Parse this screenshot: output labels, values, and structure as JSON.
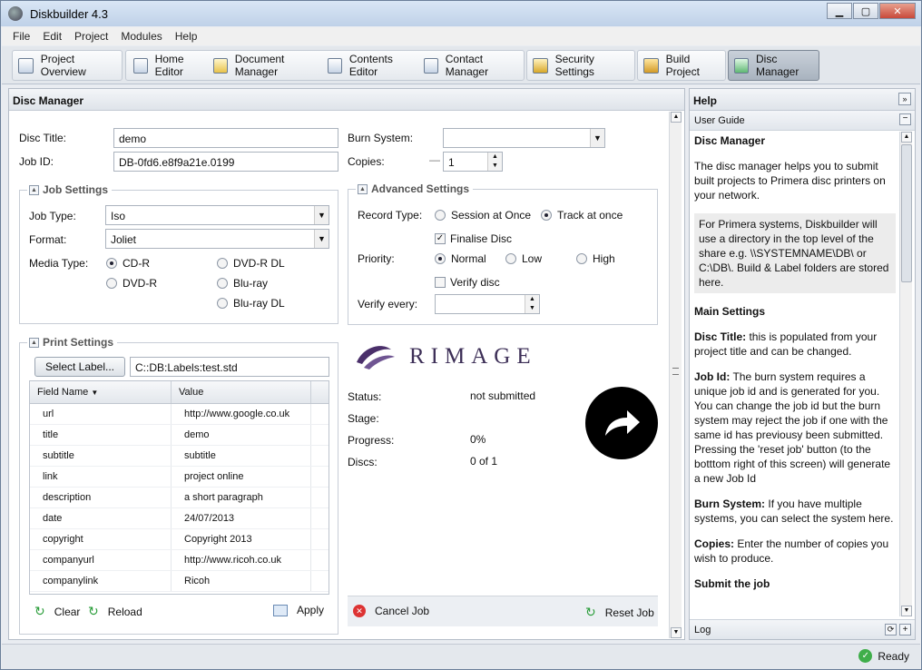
{
  "window": {
    "title": "Diskbuilder 4.3"
  },
  "menu": [
    "File",
    "Edit",
    "Project",
    "Modules",
    "Help"
  ],
  "toolbar": [
    "Project Overview",
    "Home Editor",
    "Document Manager",
    "Contents Editor",
    "Contact Manager",
    "Security Settings",
    "Build Project",
    "Disc Manager"
  ],
  "disc": {
    "header": "Disc Manager",
    "title_label": "Disc Title:",
    "title_value": "demo",
    "jobid_label": "Job ID:",
    "jobid_value": "DB-0fd6.e8f9a21e.0199",
    "burn_label": "Burn System:",
    "burn_value": "",
    "copies_label": "Copies:",
    "copies_value": "1",
    "job_settings": {
      "legend": "Job Settings",
      "type_label": "Job Type:",
      "type_value": "Iso",
      "format_label": "Format:",
      "format_value": "Joliet",
      "media_label": "Media Type:",
      "media": [
        "CD-R",
        "DVD-R DL",
        "DVD-R",
        "Blu-ray",
        "Blu-ray DL"
      ]
    },
    "advanced": {
      "legend": "Advanced Settings",
      "record_label": "Record Type:",
      "record_opts": [
        "Session at Once",
        "Track at once"
      ],
      "finalise": "Finalise Disc",
      "priority_label": "Priority:",
      "priority_opts": [
        "Normal",
        "Low",
        "High"
      ],
      "verify": "Verify disc",
      "verify_every": "Verify every:"
    },
    "print": {
      "legend": "Print Settings",
      "select_label": "Select Label...",
      "label_path": "C::DB:Labels:test.std",
      "col_field": "Field Name",
      "col_value": "Value",
      "rows": [
        [
          "url",
          "http://www.google.co.uk"
        ],
        [
          "title",
          "demo"
        ],
        [
          "subtitle",
          "subtitle"
        ],
        [
          "link",
          "project online"
        ],
        [
          "description",
          "a short paragraph"
        ],
        [
          "date",
          "24/07/2013"
        ],
        [
          "copyright",
          "Copyright 2013"
        ],
        [
          "companyurl",
          "http://www.ricoh.co.uk"
        ],
        [
          "companylink",
          "Ricoh"
        ]
      ],
      "clear": "Clear",
      "reload": "Reload",
      "apply": "Apply"
    },
    "brand": "RIMAGE",
    "status": {
      "status_label": "Status:",
      "status_value": "not submitted",
      "stage_label": "Stage:",
      "progress_label": "Progress:",
      "progress_value": "0%",
      "discs_label": "Discs:",
      "discs_value": "0 of 1"
    },
    "cancel": "Cancel Job",
    "reset": "Reset Job"
  },
  "help": {
    "header": "Help",
    "guide": "User Guide",
    "log": "Log",
    "h1": "Disc Manager",
    "p1": "The disc manager helps you to submit built projects to Primera disc printers on your network.",
    "note": "For Primera systems, Diskbuilder will use a directory in the top level of the share e.g. \\\\SYSTEMNAME\\DB\\ or C:\\DB\\. Build & Label folders are stored here.",
    "h2": "Main Settings",
    "t1": "Disc Title:",
    "d1": " this is populated from your project title and can be changed.",
    "t2": "Job Id:",
    "d2": " The burn system requires a unique job id and is generated for you. You can change the job id but the burn system may reject the job if one with the same id has previousy been submitted. Pressing the 'reset job' button (to the botttom right of this screen) will generate a new Job Id",
    "t3": "Burn System:",
    "d3": " If you have multiple systems, you can select the system here.",
    "t4": "Copies:",
    "d4": " Enter the number of copies you wish to produce.",
    "h3": "Submit the job"
  },
  "statusbar": "Ready"
}
